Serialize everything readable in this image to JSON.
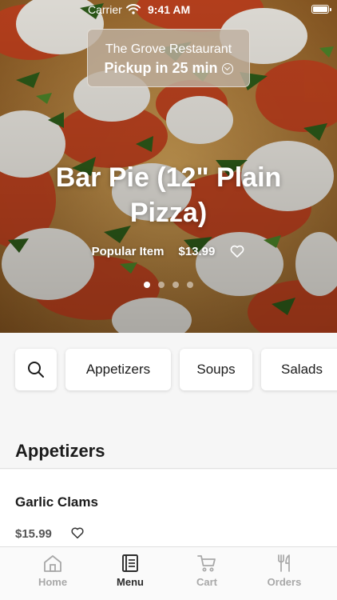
{
  "status_bar": {
    "carrier": "Carrier",
    "time": "9:41 AM"
  },
  "pickup": {
    "restaurant": "The Grove Restaurant",
    "pickup_text": "Pickup in 25 min"
  },
  "featured": {
    "title": "Bar Pie (12\" Plain Pizza)",
    "badge": "Popular Item",
    "price": "$13.99",
    "carousel_total": 4,
    "carousel_active": 1
  },
  "categories": [
    "Appetizers",
    "Soups",
    "Salads"
  ],
  "section": {
    "title": "Appetizers",
    "items": [
      {
        "name": "Garlic Clams",
        "price": "$15.99"
      }
    ]
  },
  "tabs": [
    {
      "label": "Home",
      "icon": "home-icon",
      "active": false
    },
    {
      "label": "Menu",
      "icon": "menu-book-icon",
      "active": true
    },
    {
      "label": "Cart",
      "icon": "cart-icon",
      "active": false
    },
    {
      "label": "Orders",
      "icon": "cutlery-icon",
      "active": false
    }
  ],
  "colors": {
    "background": "#f6f6f6",
    "active_tab": "#2b2b2b",
    "inactive_tab": "#a8a8a8"
  }
}
